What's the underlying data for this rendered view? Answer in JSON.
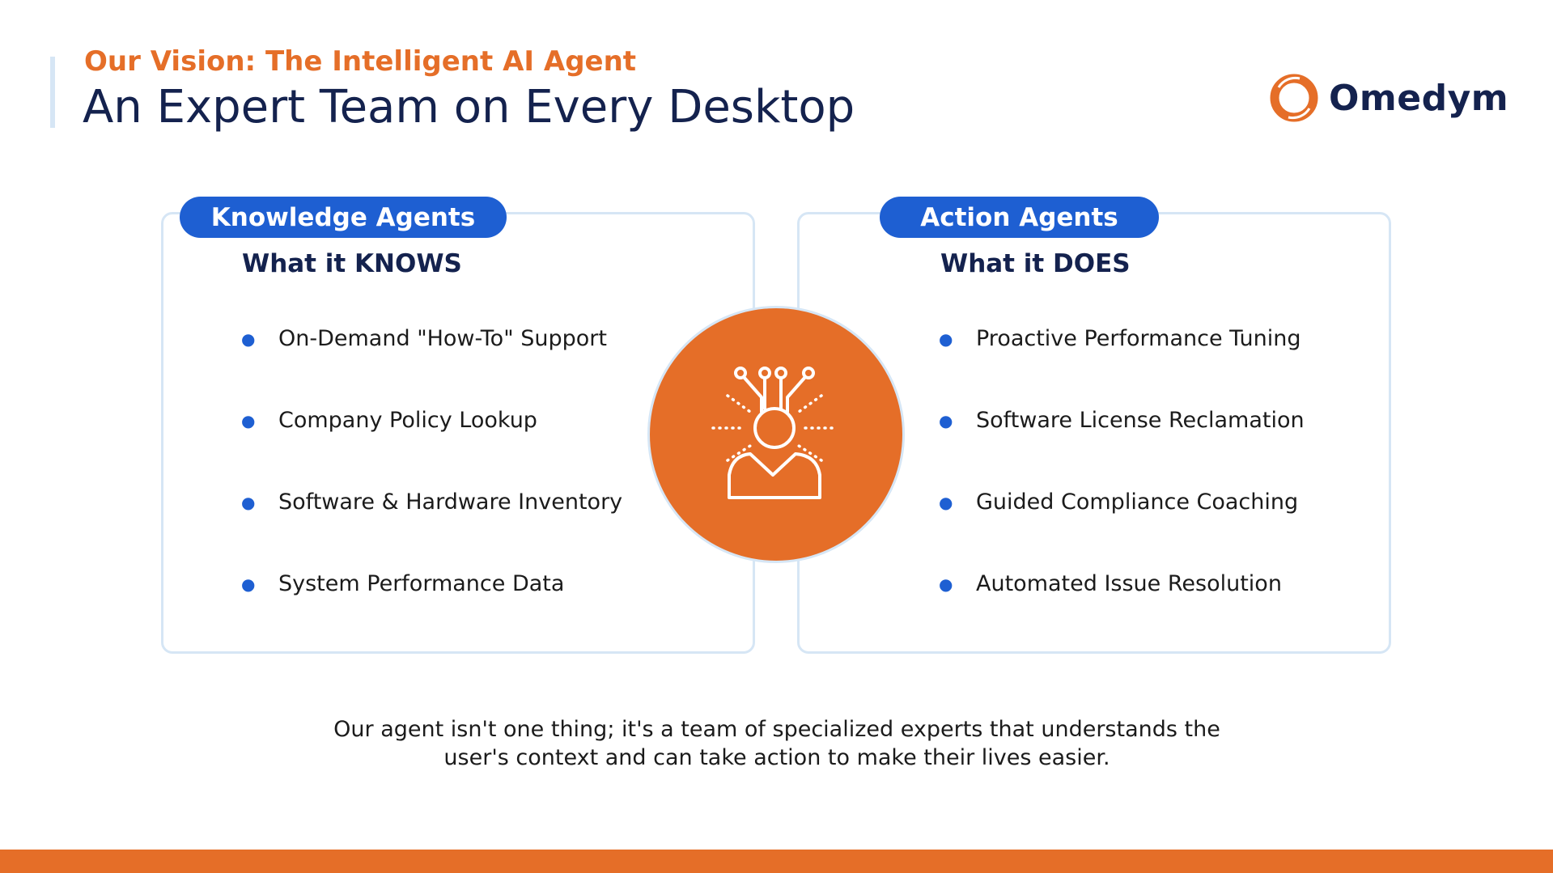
{
  "header": {
    "eyebrow": "Our Vision: The Intelligent AI Agent",
    "title": "An Expert Team on Every Desktop"
  },
  "logo": {
    "text": "Omedym",
    "icon": "omedym-ring-icon"
  },
  "left_panel": {
    "pill": "Knowledge Agents",
    "subhead": "What it KNOWS",
    "items": [
      "On-Demand \"How-To\" Support",
      "Company Policy Lookup",
      "Software & Hardware Inventory",
      "System Performance Data"
    ]
  },
  "right_panel": {
    "pill": "Action Agents",
    "subhead": "What it DOES",
    "items": [
      "Proactive Performance Tuning",
      "Software License Reclamation",
      "Guided Compliance Coaching",
      "Automated Issue Resolution"
    ]
  },
  "center": {
    "icon": "ai-agent-person-icon"
  },
  "caption": {
    "line1": "Our agent isn't one thing; it's a team of specialized experts that understands the",
    "line2": "user's context and can take action to make their lives easier."
  },
  "colors": {
    "orange": "#e56e28",
    "navy": "#14224e",
    "blue": "#1e5fd2",
    "panel_border": "#d6e6f5"
  }
}
